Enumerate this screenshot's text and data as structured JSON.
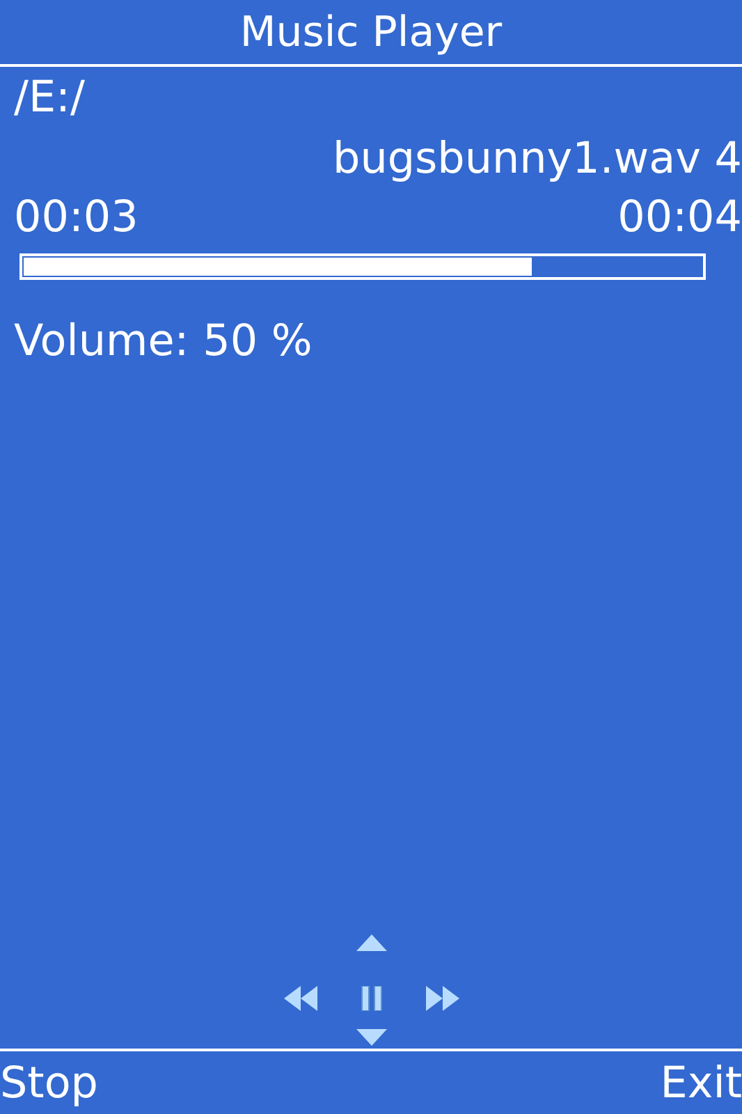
{
  "title": "Music Player",
  "path": "/E:/",
  "track": "bugsbunny1.wav 4",
  "elapsed": "00:03",
  "duration": "00:04",
  "progress": {
    "level": 0.75
  },
  "volume": "Volume: 50 %",
  "softkeys": {
    "left": "Stop",
    "right": "Exit"
  }
}
